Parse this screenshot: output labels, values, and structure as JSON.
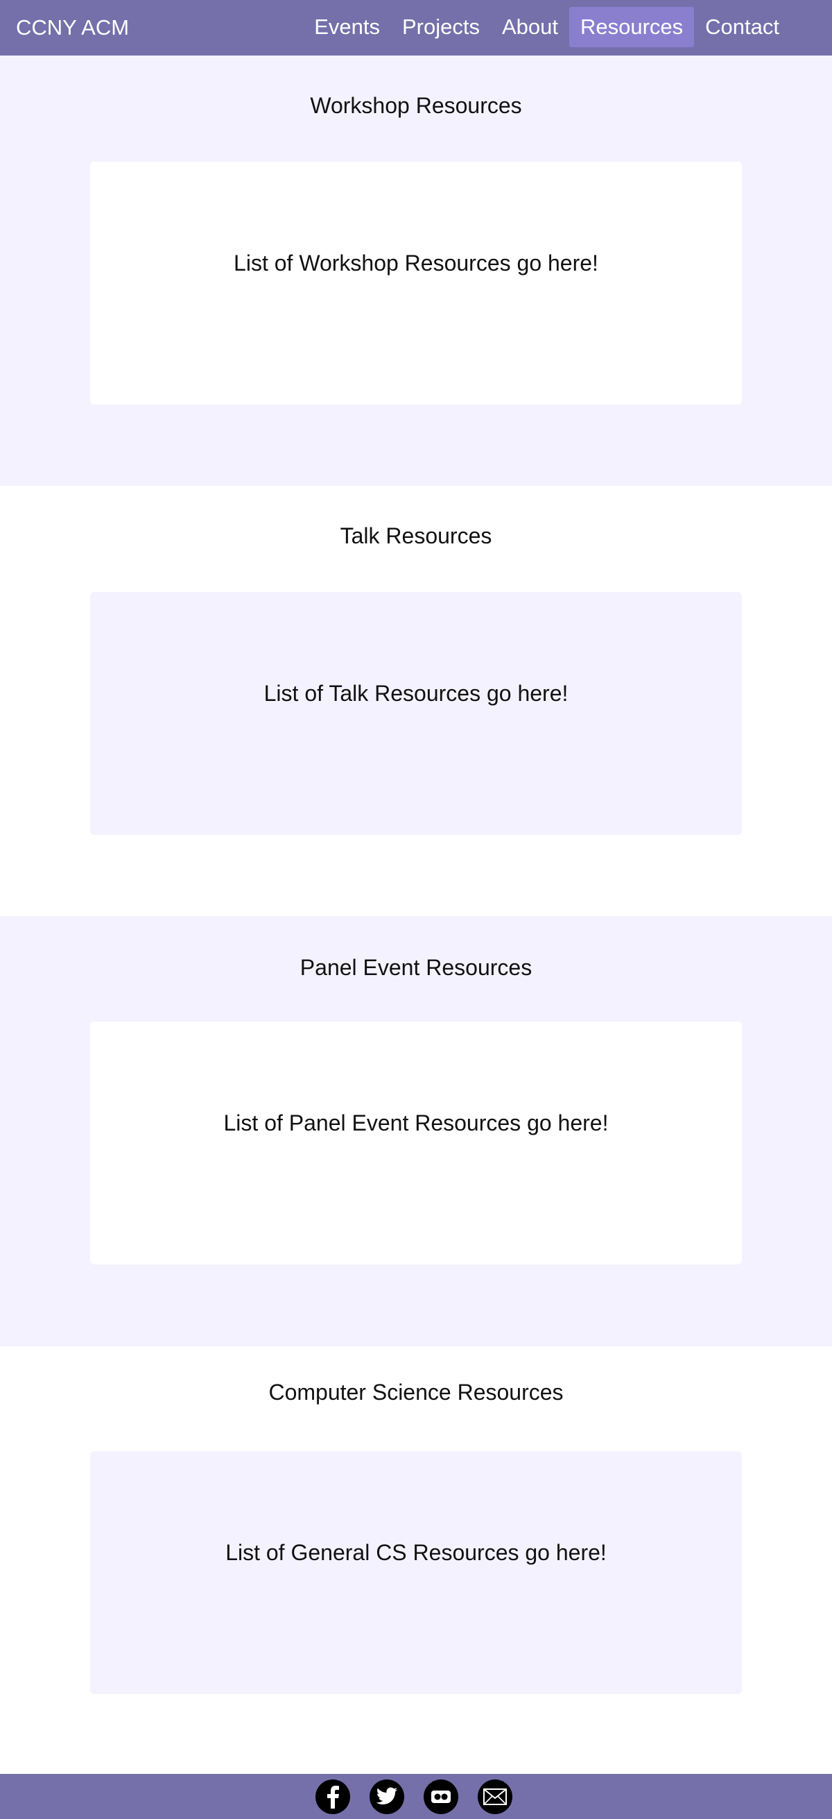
{
  "nav": {
    "brand": "CCNY ACM",
    "links": [
      {
        "label": "Events"
      },
      {
        "label": "Projects"
      },
      {
        "label": "About"
      },
      {
        "label": "Resources"
      },
      {
        "label": "Contact"
      }
    ],
    "active": "Resources",
    "colors": {
      "bar": "#7570aa",
      "active": "#8a7fcf"
    }
  },
  "sections": [
    {
      "title": "Workshop Resources",
      "body": "List of Workshop Resources go here!"
    },
    {
      "title": "Talk Resources",
      "body": "List of Talk Resources go here!"
    },
    {
      "title": "Panel Event Resources",
      "body": "List of Panel Event Resources go here!"
    },
    {
      "title": "Computer Science Resources",
      "body": "List of General CS Resources go here!"
    }
  ],
  "footer": {
    "icons": [
      "facebook-icon",
      "twitter-icon",
      "flickr-icon",
      "email-icon"
    ]
  },
  "colors": {
    "tint": "#f4f2fe",
    "white": "#ffffff"
  }
}
